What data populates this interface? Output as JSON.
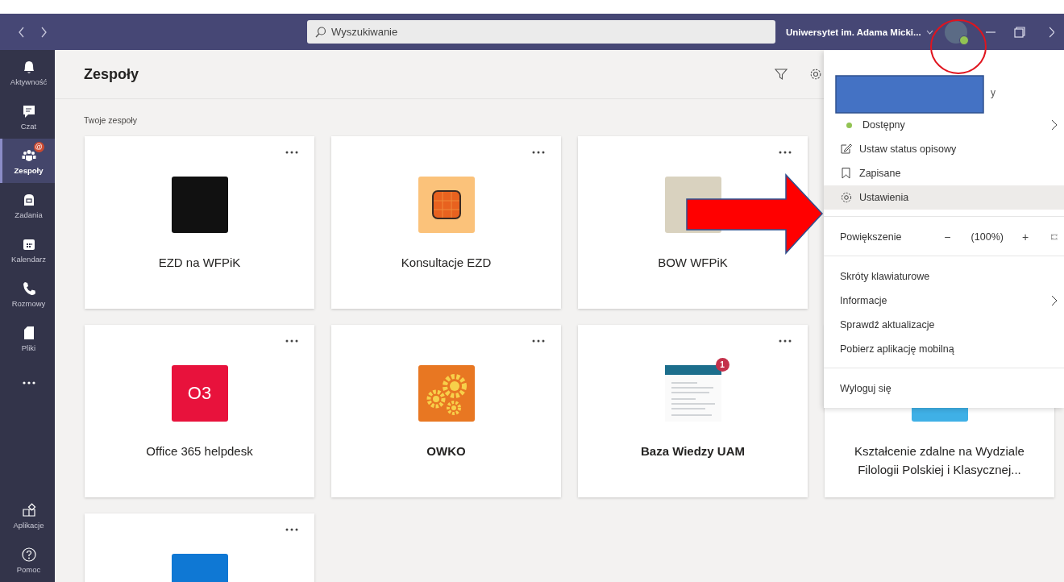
{
  "title_bar": {
    "search": {
      "placeholder": "Wyszukiwanie"
    },
    "organization": "Uniwersytet im. Adama Micki..."
  },
  "sidebar": {
    "items": [
      {
        "kind": "activity",
        "label": "Aktywność",
        "selected": false
      },
      {
        "kind": "chat",
        "label": "Czat",
        "selected": false
      },
      {
        "kind": "teams",
        "label": "Zespoły",
        "selected": true,
        "badge": "@"
      },
      {
        "kind": "tasks",
        "label": "Zadania",
        "selected": false
      },
      {
        "kind": "calendar",
        "label": "Kalendarz",
        "selected": false
      },
      {
        "kind": "calls",
        "label": "Rozmowy",
        "selected": false
      },
      {
        "kind": "files",
        "label": "Pliki",
        "selected": false
      },
      {
        "kind": "more",
        "selected": false
      }
    ],
    "bottom_items": [
      {
        "kind": "apps",
        "label": "Aplikacje",
        "selected": false
      },
      {
        "kind": "help",
        "label": "Pomoc",
        "selected": false
      }
    ]
  },
  "header": {
    "title": "Zespoły"
  },
  "section_title": "Twoje zespoły",
  "card_rows": [
    [
      {
        "name": "EZD na WFPiK",
        "unread": false,
        "more": true,
        "logo": {
          "kind": "picture",
          "color": "#111111"
        }
      },
      {
        "name": "Konsultacje EZD",
        "unread": false,
        "more": true,
        "logo": {
          "kind": "squares",
          "color": "#fbc27a"
        }
      },
      {
        "name": "BOW WFPiK",
        "unread": false,
        "more": true,
        "logo": {
          "kind": "picture",
          "color": "#d9d2bf"
        }
      }
    ],
    [
      {
        "name": "Office 365 helpdesk",
        "unread": false,
        "more": true,
        "logo": {
          "kind": "initials",
          "text": "O3",
          "color": "#e8123c"
        }
      },
      {
        "name": "OWKO",
        "unread": true,
        "more": true,
        "logo": {
          "kind": "gears",
          "color": "#e87722"
        }
      },
      {
        "name": "Baza Wiedzy UAM",
        "unread": true,
        "more": true,
        "logo": {
          "kind": "screenshot",
          "color": "#1c6e8c",
          "badge": "1"
        }
      },
      {
        "name": "Kształcenie zdalne na Wydziale Filologii Polskiej i Klasycznej...",
        "unread": false,
        "logo": {
          "kind": "tile",
          "color": "#3fb0e6"
        }
      }
    ],
    [
      {
        "more": true,
        "logo": {
          "kind": "tile",
          "color": "#0f78d4"
        }
      }
    ]
  ],
  "menu": {
    "profile_text": "y",
    "groups": [
      [
        {
          "kind": "status",
          "label": "Dostępny",
          "color": "#92c353",
          "submenu": true,
          "selected": false
        },
        {
          "kind": "edit",
          "label": "Ustaw status opisowy",
          "submenu": false,
          "selected": false
        },
        {
          "kind": "bookmark",
          "label": "Zapisane",
          "submenu": false,
          "selected": false
        },
        {
          "kind": "settings",
          "label": "Ustawienia",
          "submenu": false,
          "selected": true
        }
      ],
      [
        {
          "kind": "zoom",
          "label": "Powiększenie",
          "decrease": "−",
          "value": "(100%)",
          "increase": "+"
        }
      ],
      [
        {
          "kind": "plain",
          "label": "Skróty klawiaturowe",
          "submenu": false,
          "selected": false
        },
        {
          "kind": "plain",
          "label": "Informacje",
          "submenu": true,
          "selected": false
        },
        {
          "kind": "plain",
          "label": "Sprawdź aktualizacje",
          "submenu": false,
          "selected": false
        },
        {
          "kind": "plain",
          "label": "Pobierz aplikację mobilną",
          "submenu": false,
          "selected": false
        }
      ],
      [
        {
          "kind": "plain",
          "label": "Wyloguj się",
          "submenu": false,
          "selected": false
        }
      ]
    ]
  },
  "annotations": [
    {
      "kind": "arrow"
    },
    {
      "kind": "circle"
    },
    {
      "kind": "redaction"
    }
  ]
}
